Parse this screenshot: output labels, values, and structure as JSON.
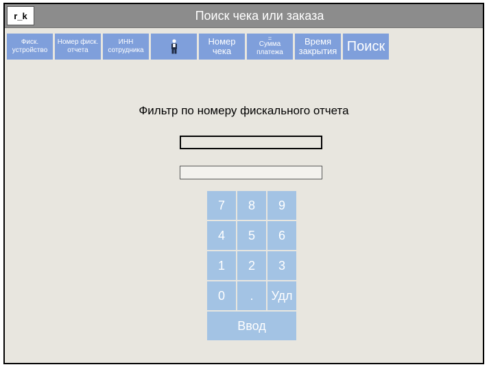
{
  "app": {
    "logo": "r_k",
    "title": "Поиск чека или заказа"
  },
  "toolbar": {
    "fiscal_device": [
      "Фиск.",
      "устройство"
    ],
    "fiscal_report_no": [
      "Номер фиск.",
      "отчета"
    ],
    "employee_inn": [
      "ИНН",
      "сотрудника"
    ],
    "receipt_no": [
      "Номер",
      "чека"
    ],
    "payment_sum": {
      "marker": "=",
      "lines": [
        "Сумма",
        "платежа"
      ]
    },
    "close_time": [
      "Время",
      "закрытия"
    ],
    "search": "Поиск"
  },
  "filter": {
    "heading": "Фильтр по номеру фискального отчета",
    "value": ""
  },
  "keypad": {
    "rows": [
      [
        "7",
        "8",
        "9"
      ],
      [
        "4",
        "5",
        "6"
      ],
      [
        "1",
        "2",
        "3"
      ],
      [
        "0",
        ".",
        "Удл"
      ]
    ],
    "enter": "Ввод"
  },
  "colors": {
    "toolbar_button": "#7f9fdb",
    "keypad_key": "#a3c3e4",
    "title_bar": "#8c8c8c",
    "background": "#e8e6df"
  }
}
